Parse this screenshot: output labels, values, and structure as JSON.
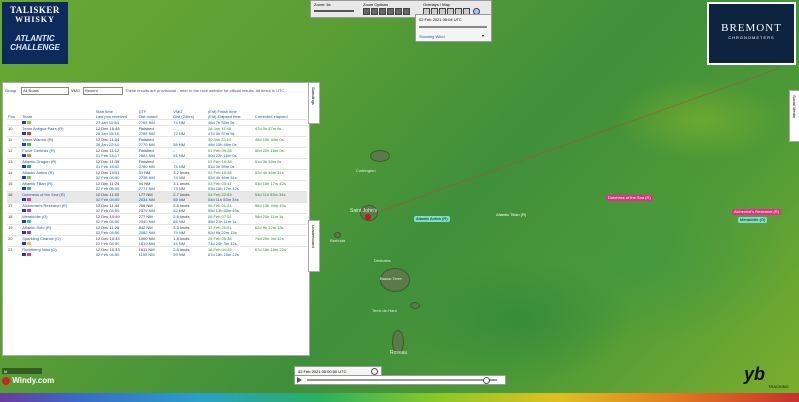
{
  "logo": {
    "line1": "TALISKER",
    "line2": "WHISKY",
    "line3": "ATLANTIC",
    "line4": "CHALLENGE"
  },
  "toolbar": {
    "zoom": "Zoom: 6x",
    "zoom_options": "Zoom Options",
    "overlays": "Overlays / Map"
  },
  "datebox": {
    "date": "02 Feb 2021 05:04 UTC",
    "showing": "Showing Wind"
  },
  "bremont": {
    "name": "BREMONT",
    "sub": "CHRONOMETERS"
  },
  "panel": {
    "group_label": "Group",
    "group_value": "All Boats",
    "vmg_label": "VMG",
    "vmg_value": "Recent",
    "note": "These results are provisional - refer to the race website for official results. All times in UTC.",
    "headers": {
      "pos": "Pos",
      "team": "Team",
      "start": "Start time",
      "last": "Last pos received",
      "dtf": "DTF",
      "rowed": "Dist rowed",
      "vmg": "VMG",
      "dist24": "Dist (24hrs)",
      "finish": "(Est) Finish time",
      "elapsed": "(Est) Elapsed time",
      "corrected": "Corrected elapsed"
    },
    "rows": [
      {
        "pos": "",
        "team": "",
        "start": "",
        "last": "27 Jan 10:54",
        "dtf": "",
        "rowed": "2765 NM",
        "vmg": "",
        "d24": "74 NM",
        "finish": "",
        "elapsed": "46d 7h 55m 9s",
        "corr": ""
      },
      {
        "pos": "10",
        "team": "Team Antigua Pairs (R)",
        "start": "12 Dec 16:48",
        "last": "28 Jan 18:15",
        "dtf": "Finished",
        "rowed": "2785 NM",
        "vmg": "-",
        "d24": "72 NM",
        "finish": "28 Jan 17:45",
        "elapsed": "47d 0h 57m 9s",
        "corr": "47d 0h 57m 9s"
      },
      {
        "pos": "11",
        "team": "Wave Warrior (R)",
        "start": "12 Dec 11:34",
        "last": "30 Jan 22:44",
        "dtf": "Finished",
        "rowed": "2770 NM",
        "vmg": "-",
        "d24": "58 NM",
        "finish": "30 Jan 22:14",
        "elapsed": "48d 10h 40m 0s",
        "corr": "48d 10h 40m 0s"
      },
      {
        "pos": "12",
        "team": "Force Genesis (R)",
        "start": "12 Dec 11:12",
        "last": "01 Feb 18:17",
        "dtf": "Finished",
        "rowed": "2683 NM",
        "vmg": "-",
        "d24": "61 NM",
        "finish": "01 Feb 09:28",
        "elapsed": "50d 22h 16m 0s",
        "corr": "50d 22h 16m 0s"
      },
      {
        "pos": "13",
        "team": "Atlantic Dragon (R)",
        "start": "12 Dec 11:39",
        "last": "01 Feb 15:52",
        "dtf": "Finished",
        "rowed": "2790 NM",
        "vmg": "-",
        "d24": "75 NM",
        "finish": "01 Feb 15:38",
        "elapsed": "51d 3h 59m 0s",
        "corr": "51d 3h 59m 0s"
      },
      {
        "pos": "14",
        "team": "Atlantic Antics (R)",
        "start": "12 Dec 10:51",
        "last": "02 Feb 04:50",
        "dtf": "31 NM",
        "rowed": "2738 NM",
        "vmg": "3.2 knots",
        "d24": "74 NM",
        "finish": "02 Feb 15:38",
        "elapsed": "52d 4h 46m 31s",
        "corr": "52d 4h 46m 31s"
      },
      {
        "pos": "15",
        "team": "Atlantic Tilian (R)",
        "start": "12 Dec 11:24",
        "last": "02 Feb 06:00",
        "dtf": "94 NM",
        "rowed": "2771 NM",
        "vmg": "3.1 knots",
        "d24": "73 NM",
        "finish": "03 Feb 03:41",
        "elapsed": "53d 16h 17m 42s",
        "corr": "53d 16h 17m 42s"
      },
      {
        "pos": "16",
        "team": "Dutchess of the Sea (R)",
        "start": "12 Dec 11:00",
        "last": "02 Feb 04:50",
        "dtf": "177 NM",
        "rowed": "2634 NM",
        "vmg": "2.7 knots",
        "d24": "65 NM",
        "finish": "04 Feb 22:53",
        "elapsed": "54d 11h 53m 34s",
        "corr": "54d 11h 53m 34s"
      },
      {
        "pos": "17",
        "team": "Alchemist's Research (R)",
        "start": "12 Dec 11:44",
        "last": "02 Feb 04:50",
        "dtf": "268 NM",
        "rowed": "2579 NM",
        "vmg": "2.6 knots",
        "d24": "62 NM",
        "finish": "06 Feb 01:24",
        "elapsed": "55d 13h 40m 40s",
        "corr": "56d 13h 40m 40s"
      },
      {
        "pos": "18",
        "team": "Meraki/die (O)",
        "start": "12 Dec 10:49",
        "last": "02 Feb 04:50",
        "dtf": "277 NM",
        "rowed": "2540 NM",
        "vmg": "2.6 knots",
        "d24": "66 NM",
        "finish": "06 Feb 07:51",
        "elapsed": "55d 21h 11m 1s",
        "corr": "56d 21h 11m 1s"
      },
      {
        "pos": "19",
        "team": "Atlantic Solo (R)",
        "start": "12 Dec 11:26",
        "last": "02 Feb 04:50",
        "dtf": "842 NM",
        "rowed": "2082 NM",
        "vmg": "3.3 knots",
        "d24": "79 NM",
        "finish": "12 Feb 20:51",
        "elapsed": "62d 9h 22m 13s",
        "corr": "62d 9h 22m 13s"
      },
      {
        "pos": "20",
        "team": "Sparkling Chance (O)",
        "start": "12 Dec 10:33",
        "last": "02 Feb 04:50",
        "dtf": "1000 NM",
        "rowed": "1810 NM",
        "vmg": "1.8 knots",
        "d24": "44 NM",
        "finish": "25 Feb 05:38",
        "elapsed": "74d 20h 3m 42s",
        "corr": "74d 20h 3m 42s"
      },
      {
        "pos": "21",
        "team": "Ruddberry Mad (O)",
        "start": "12 Dec 10:33",
        "last": "02 Feb 04:50",
        "dtf": "1611 NM",
        "rowed": "1159 NM",
        "vmg": "2.5 knots",
        "d24": "59 NM",
        "finish": "18 Feb 04:49",
        "elapsed": "67d 18h 15m 22s",
        "corr": "67d 18h 15m 22s"
      }
    ]
  },
  "tabs": {
    "leaderboard": "Leaderboard",
    "standings": "Standings",
    "social": "Social Media"
  },
  "map": {
    "places": [
      "Codrington",
      "Saint John's",
      "Basse-Terre",
      "Deshaies",
      "Roseau",
      "Terre-de-Haut",
      "Barbuda"
    ],
    "boats": [
      "Atlantic Antics (R)",
      "Atlantic Tilian (R)",
      "Dutchess of the Sea (R)",
      "Alchemist's Research (R)",
      "Meraki/die (O)"
    ]
  },
  "timeline": {
    "date": "02 Feb 2021 05:00:00 UTC"
  },
  "windy": {
    "brand": "Windy.com",
    "scale": "kt"
  },
  "yb": {
    "label": "TRACKING"
  },
  "colors": {
    "highlight_row": "#e8e8e8",
    "link_blue": "#1a5aa0",
    "boat_pink": "#e0308a",
    "boat_teal": "#2ab8a0",
    "logo_blue": "#0d2a5c"
  }
}
